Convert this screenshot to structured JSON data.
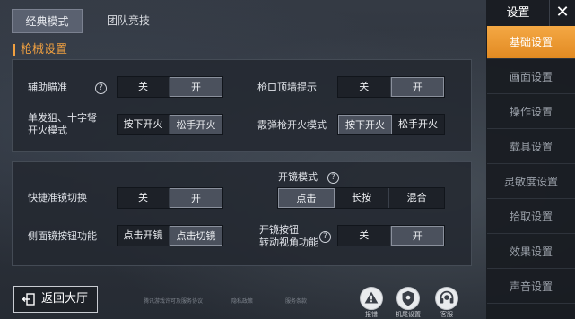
{
  "mode_tabs": [
    "经典模式",
    "团队竞技"
  ],
  "section_title": "枪械设置",
  "panel1": {
    "aim_assist": {
      "label": "辅助瞄准",
      "help": "?",
      "options": [
        "关",
        "开"
      ],
      "selected": "开"
    },
    "muzzle_hint": {
      "label": "枪口顶墙提示",
      "options": [
        "关",
        "开"
      ],
      "selected": "开"
    },
    "single_fire": {
      "label_line1": "单发狙、十字弩",
      "label_line2": "开火模式",
      "options": [
        "按下开火",
        "松手开火"
      ],
      "selected": "松手开火"
    },
    "shotgun_fire": {
      "label": "霰弹枪开火模式",
      "options": [
        "按下开火",
        "松手开火"
      ],
      "selected": "按下开火"
    }
  },
  "panel2": {
    "scope_switch": {
      "label": "快捷准镜切换",
      "options": [
        "关",
        "开"
      ],
      "selected": "开"
    },
    "scope_mode": {
      "label": "开镜模式",
      "help": "?",
      "options": [
        "点击",
        "长按",
        "混合"
      ],
      "selected": "点击"
    },
    "side_scope": {
      "label": "侧面镜按钮功能",
      "options": [
        "点击开镜",
        "点击切镜"
      ],
      "selected": "点击切镜"
    },
    "scope_rotate": {
      "label_line1": "开镜按钮",
      "label_line2": "转动视角功能",
      "help": "?",
      "options": [
        "关",
        "开"
      ],
      "selected": "开"
    }
  },
  "sidebar": {
    "title": "设置",
    "close": "✕",
    "items": [
      "基础设置",
      "画面设置",
      "操作设置",
      "载具设置",
      "灵敏度设置",
      "拾取设置",
      "效果设置",
      "声音设置"
    ],
    "active": "基础设置"
  },
  "footer": {
    "back_label": "返回大厅",
    "links": [
      "腾讯游戏许可及服务协议",
      "隐私政策",
      "服务条款"
    ],
    "icons": [
      {
        "name": "report",
        "label": "报错"
      },
      {
        "name": "account-settings",
        "label": "机尾设置"
      },
      {
        "name": "customer-service",
        "label": "客服"
      }
    ]
  },
  "colors": {
    "accent": "#f0a040",
    "sidebar_active": "#e9962e"
  }
}
